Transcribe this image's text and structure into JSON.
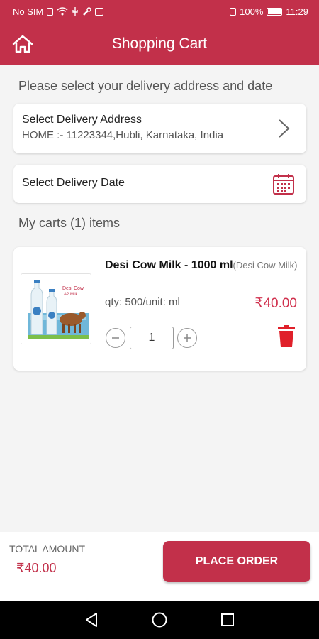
{
  "status_bar": {
    "carrier": "No SIM",
    "battery_percent": "100%",
    "time": "11:29"
  },
  "header": {
    "title": "Shopping Cart",
    "home_icon": "home-icon"
  },
  "delivery": {
    "prompt": "Please select your delivery address and date",
    "address_label": "Select Delivery Address",
    "address_value": "HOME :- 11223344,Hubli, Karnataka, India",
    "date_label": "Select Delivery Date",
    "address_icon": "chevron-right-icon",
    "date_icon": "calendar-icon"
  },
  "cart": {
    "heading": "My carts (1) items",
    "items": [
      {
        "name": "Desi Cow Milk - 1000 ml",
        "subname": "(Desi Cow Milk)",
        "qty_text": "qty: 500/unit: ml",
        "price": "₹40.00",
        "quantity": "1",
        "image": "milk-bottles-image"
      }
    ]
  },
  "footer": {
    "total_label": "TOTAL AMOUNT",
    "total_value": "₹40.00",
    "place_order_label": "PLACE ORDER"
  },
  "colors": {
    "primary": "#c2304a",
    "price": "#d0304d",
    "delete": "#e0202a"
  },
  "nav_icons": [
    "back-icon",
    "home-circle-icon",
    "recents-icon"
  ]
}
